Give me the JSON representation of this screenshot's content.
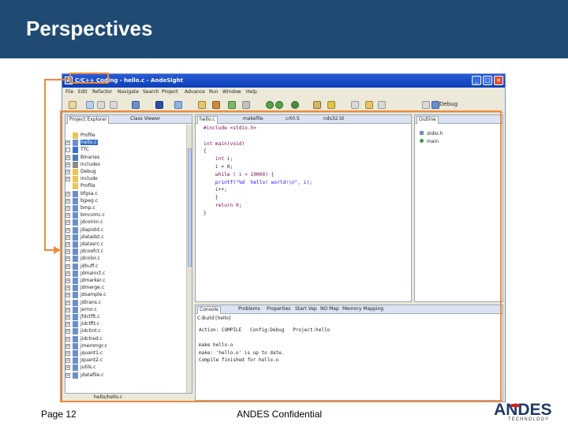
{
  "slide": {
    "title": "Perspectives",
    "page": "Page 12",
    "confidential": "ANDES Confidential",
    "logo_text": "ANDES",
    "logo_sub": "TECHNOLOGY"
  },
  "colors": {
    "header_bg": "#1f4a72",
    "annotation": "#f08a3a",
    "selection": "#316ac5"
  },
  "ide": {
    "title": "C/C++ Coding - hello.c - AndeSight",
    "menu": [
      "File",
      "Edit",
      "Refactor",
      "Navigate",
      "Search",
      "Project",
      "Advance",
      "Run",
      "Window",
      "Help"
    ],
    "perspective": "Debug",
    "explorer": {
      "tabs": [
        "Project Explorer",
        "Class Viewer"
      ],
      "items": [
        {
          "label": "Profile",
          "icon": "folder-icon",
          "exp": ""
        },
        {
          "label": "hello.c",
          "icon": "c-file-icon",
          "exp": "+",
          "selected": true
        },
        {
          "label": "TTC",
          "icon": "project-icon",
          "exp": "-"
        },
        {
          "label": "Binaries",
          "icon": "binaries-icon",
          "exp": "+"
        },
        {
          "label": "Includes",
          "icon": "includes-icon",
          "exp": "+"
        },
        {
          "label": "Debug",
          "icon": "folder-icon",
          "exp": "+"
        },
        {
          "label": "include",
          "icon": "folder-icon",
          "exp": "+"
        },
        {
          "label": "Profile",
          "icon": "folder-icon",
          "exp": ""
        },
        {
          "label": "bfgsa.c",
          "icon": "c-file-icon",
          "exp": "+"
        },
        {
          "label": "bjpeg.c",
          "icon": "c-file-icon",
          "exp": "+"
        },
        {
          "label": "bmp.c",
          "icon": "c-file-icon",
          "exp": "+"
        },
        {
          "label": "bmcomc.c",
          "icon": "c-file-icon",
          "exp": "+"
        },
        {
          "label": "jdcoinin.c",
          "icon": "c-file-icon",
          "exp": "+"
        },
        {
          "label": "jdapistd.c",
          "icon": "c-file-icon",
          "exp": "+"
        },
        {
          "label": "jdatadst.c",
          "icon": "c-file-icon",
          "exp": "+"
        },
        {
          "label": "jdatasrc.c",
          "icon": "c-file-icon",
          "exp": "+"
        },
        {
          "label": "jdcoefct.c",
          "icon": "c-file-icon",
          "exp": "+"
        },
        {
          "label": "jdcolor.c",
          "icon": "c-file-icon",
          "exp": "+"
        },
        {
          "label": "jdhuff.c",
          "icon": "c-file-icon",
          "exp": "+"
        },
        {
          "label": "jdmainct.c",
          "icon": "c-file-icon",
          "exp": "+"
        },
        {
          "label": "jdmarker.c",
          "icon": "c-file-icon",
          "exp": "+"
        },
        {
          "label": "jdmerge.c",
          "icon": "c-file-icon",
          "exp": "+"
        },
        {
          "label": "jdsample.c",
          "icon": "c-file-icon",
          "exp": "+"
        },
        {
          "label": "jdtrans.c",
          "icon": "c-file-icon",
          "exp": "+"
        },
        {
          "label": "jerror.c",
          "icon": "c-file-icon",
          "exp": "+"
        },
        {
          "label": "jfdctflt.c",
          "icon": "c-file-icon",
          "exp": "+"
        },
        {
          "label": "jidctflt.c",
          "icon": "c-file-icon",
          "exp": "+"
        },
        {
          "label": "jidctint.c",
          "icon": "c-file-icon",
          "exp": "+"
        },
        {
          "label": "jidctred.c",
          "icon": "c-file-icon",
          "exp": "+"
        },
        {
          "label": "jmemmgr.c",
          "icon": "c-file-icon",
          "exp": "+"
        },
        {
          "label": "jquant1.c",
          "icon": "c-file-icon",
          "exp": "+"
        },
        {
          "label": "jquant2.c",
          "icon": "c-file-icon",
          "exp": "+"
        },
        {
          "label": "jutils.c",
          "icon": "c-file-icon",
          "exp": "+"
        },
        {
          "label": "jdatafile.c",
          "icon": "c-file-icon",
          "exp": "+"
        }
      ],
      "status": "hello/hello.c"
    },
    "editor": {
      "tabs": [
        "hello.c",
        "makefile",
        "crt0.S",
        "nds32.ld"
      ],
      "lines": [
        {
          "t": "#include <stdio.h>",
          "k": "inc"
        },
        {
          "t": "",
          "k": ""
        },
        {
          "t": "int main(void)",
          "k": "fn"
        },
        {
          "t": "{",
          "k": ""
        },
        {
          "t": "    int i;",
          "k": "decl"
        },
        {
          "t": "    i = 0;",
          "k": ""
        },
        {
          "t": "    while ( i < 10000) {",
          "k": "while"
        },
        {
          "t": "    printf(\"%d  hello! world!\\n\", i);",
          "k": "print"
        },
        {
          "t": "    i++;",
          "k": ""
        },
        {
          "t": "    }",
          "k": ""
        },
        {
          "t": "    return 0;",
          "k": "ret"
        },
        {
          "t": "}",
          "k": ""
        }
      ]
    },
    "outline": {
      "tab": "Outline",
      "items": [
        "stdio.h",
        "main"
      ]
    },
    "console": {
      "tabs": [
        "Console",
        "Problems",
        "Properties",
        "Start Vep",
        "NO Map",
        "Memory Mapping"
      ],
      "header": "C-Build [hello]",
      "lines": [
        "Action: COMPILE   Config:Debug   Project:hello",
        "",
        "make hello.o",
        "make: 'hello.o' is up to date.",
        "Compile finished for hello.o"
      ]
    }
  }
}
